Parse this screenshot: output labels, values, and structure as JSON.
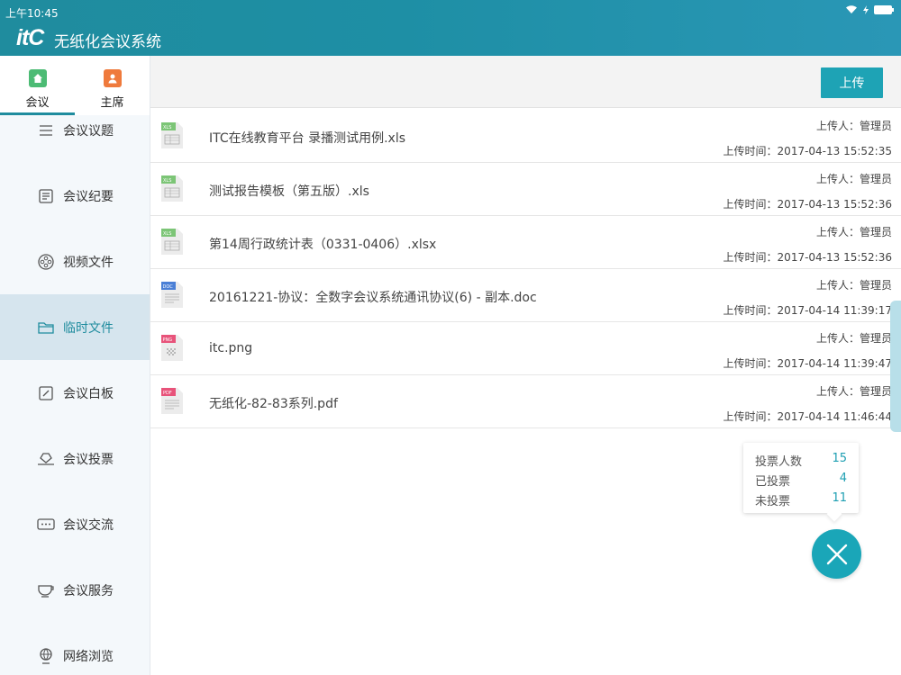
{
  "status_bar": {
    "time": "上午10:45"
  },
  "header": {
    "logo": "itC",
    "title": "无纸化会议系统"
  },
  "sidebar": {
    "tabs": [
      {
        "label": "会议",
        "icon": "home-icon",
        "color": "#4cbb74"
      },
      {
        "label": "主席",
        "icon": "person-icon",
        "color": "#ef7a3c"
      }
    ],
    "items": [
      {
        "label": "会议议题",
        "icon": "agenda-icon"
      },
      {
        "label": "会议纪要",
        "icon": "minutes-icon"
      },
      {
        "label": "视频文件",
        "icon": "video-reel-icon"
      },
      {
        "label": "临时文件",
        "icon": "folder-icon"
      },
      {
        "label": "会议白板",
        "icon": "whiteboard-icon"
      },
      {
        "label": "会议投票",
        "icon": "vote-icon"
      },
      {
        "label": "会议交流",
        "icon": "chat-icon"
      },
      {
        "label": "会议服务",
        "icon": "tea-cup-icon"
      },
      {
        "label": "网络浏览",
        "icon": "globe-icon"
      }
    ]
  },
  "toolbar": {
    "upload_label": "上传"
  },
  "files": [
    {
      "name": "ITC在线教育平台 录播测试用例.xls",
      "type": "XLS",
      "uploader": "上传人：管理员",
      "time": "上传时间：2017-04-13 15:52:35"
    },
    {
      "name": "测试报告模板（第五版）.xls",
      "type": "XLS",
      "uploader": "上传人：管理员",
      "time": "上传时间：2017-04-13 15:52:36"
    },
    {
      "name": "第14周行政统计表（0331-0406）.xlsx",
      "type": "XLS",
      "uploader": "上传人：管理员",
      "time": "上传时间：2017-04-13 15:52:36"
    },
    {
      "name": "20161221-协议：全数字会议系统通讯协议(6) - 副本.doc",
      "type": "DOC",
      "uploader": "上传人：管理员",
      "time": "上传时间：2017-04-14 11:39:17"
    },
    {
      "name": "itc.png",
      "type": "PNG",
      "uploader": "上传人：管理员",
      "time": "上传时间：2017-04-14 11:39:47"
    },
    {
      "name": "无纸化-82-83系列.pdf",
      "type": "PDF",
      "uploader": "上传人：管理员",
      "time": "上传时间：2017-04-14 11:46:44"
    }
  ],
  "vote_summary": {
    "rows": [
      {
        "label": "投票人数",
        "value": "15"
      },
      {
        "label": "已投票",
        "value": "4"
      },
      {
        "label": "未投票",
        "value": "11"
      }
    ]
  },
  "colors": {
    "accent": "#1ea3b5",
    "header": "#1f8c9e",
    "xls": "#7cc576",
    "doc": "#4a7fd6",
    "png": "#e8537a",
    "pdf": "#e8537a"
  }
}
